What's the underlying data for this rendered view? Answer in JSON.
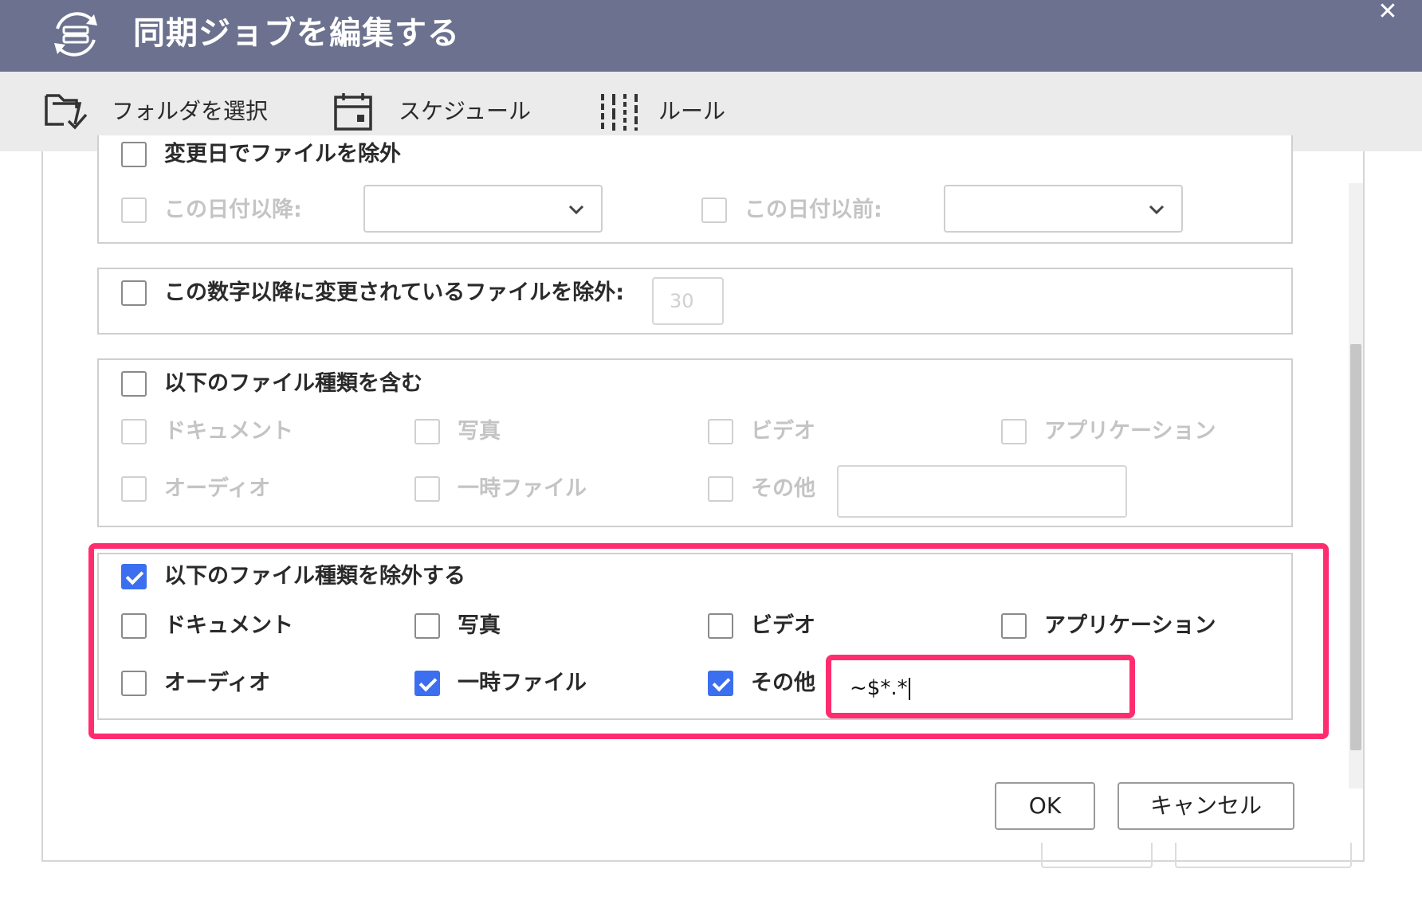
{
  "dialog": {
    "title": "同期ジョブを編集する",
    "close_label": "✕"
  },
  "tabs": [
    {
      "label": "フォルダを選択",
      "icon": "folder-check-icon"
    },
    {
      "label": "スケジュール",
      "icon": "calendar-icon"
    },
    {
      "label": "ルール",
      "icon": "sliders-icon",
      "active": true
    }
  ],
  "modified_date": {
    "header_label": "変更日でファイルを除外",
    "after_label": "この日付以降:",
    "after_value": "",
    "before_label": "この日付以前:",
    "before_value": ""
  },
  "modified_days": {
    "label": "この数字以降に変更されているファイルを除外:",
    "value": "30"
  },
  "include_types": {
    "header_label": "以下のファイル種類を含む",
    "checked": false,
    "types": {
      "document": "ドキュメント",
      "photo": "写真",
      "video": "ビデオ",
      "application": "アプリケーション",
      "audio": "オーディオ",
      "temp": "一時ファイル",
      "other": "その他"
    },
    "other_value": ""
  },
  "exclude_types": {
    "header_label": "以下のファイル種類を除外する",
    "checked": true,
    "types": {
      "document": "ドキュメント",
      "photo": "写真",
      "video": "ビデオ",
      "application": "アプリケーション",
      "audio": "オーディオ",
      "temp": "一時ファイル",
      "other": "その他"
    },
    "checked_types": [
      "temp",
      "other"
    ],
    "other_value": "~$*.*"
  },
  "buttons": {
    "ok": "OK",
    "cancel": "キャンセル"
  },
  "colors": {
    "titlebar": "#6b718e",
    "accent": "#3c6ff0",
    "highlight": "#ff2d6f"
  }
}
